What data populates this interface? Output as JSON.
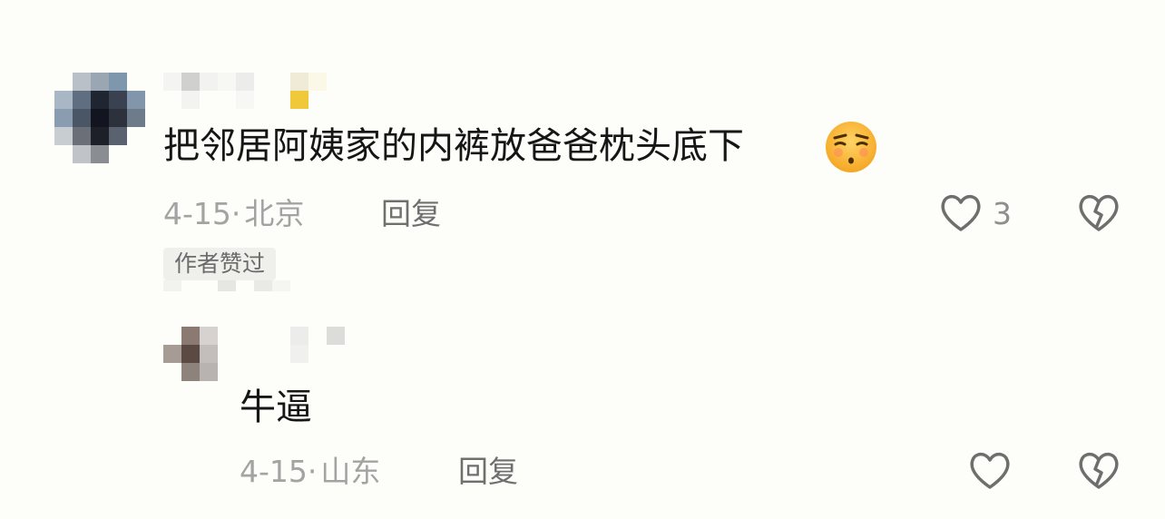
{
  "comments": [
    {
      "text": "把邻居阿姨家的内裤放爸爸枕头底下",
      "emoji": "smirk-face-emoji",
      "date": "4-15",
      "separator": "·",
      "location": "北京",
      "reply_label": "回复",
      "like_count": "3",
      "author_liked_badge": "作者赞过"
    },
    {
      "text": "牛逼",
      "date": "4-15",
      "separator": "·",
      "location": "山东",
      "reply_label": "回复"
    }
  ],
  "colors": {
    "background": "#fdfdf9",
    "text": "#161616",
    "meta": "#a3a3a3",
    "reply": "#6f6f6f",
    "icon": "#6e6e6e",
    "emoji_face": "#f7b531"
  },
  "icons": {
    "like": "heart-outline-icon",
    "dislike": "broken-heart-icon"
  }
}
